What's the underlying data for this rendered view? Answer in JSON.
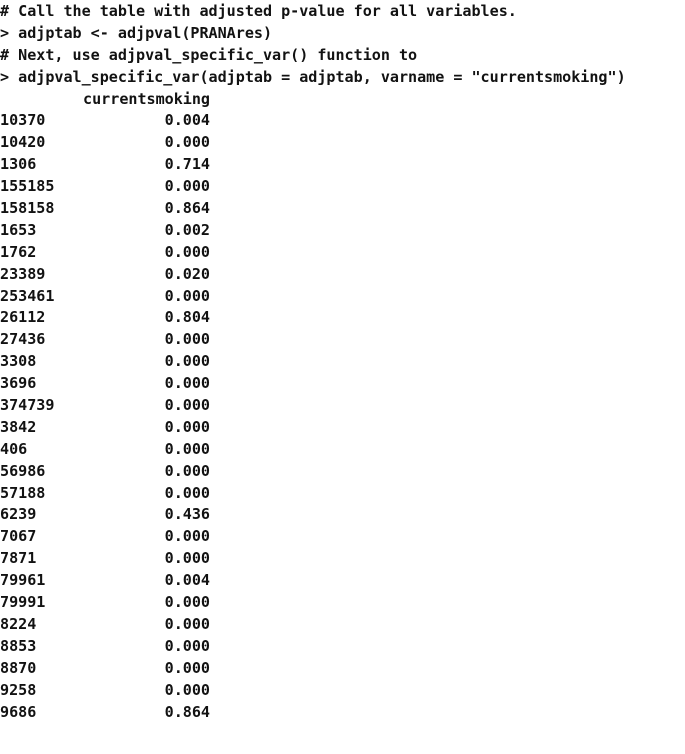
{
  "console": {
    "prompt_symbol": ">",
    "comment_symbol": "#",
    "lines": [
      "# Call the table with adjusted p-value for all variables.",
      "> adjptab <- adjpval(PRANAres)",
      "# Next, use adjpval_specific_var() function to",
      "> adjpval_specific_var(adjptab = adjptab, varname = \"currentsmoking\")"
    ]
  },
  "table": {
    "column_header": "currentsmoking",
    "rows": [
      {
        "name": "10370",
        "value": "0.004"
      },
      {
        "name": "10420",
        "value": "0.000"
      },
      {
        "name": "1306",
        "value": "0.714"
      },
      {
        "name": "155185",
        "value": "0.000"
      },
      {
        "name": "158158",
        "value": "0.864"
      },
      {
        "name": "1653",
        "value": "0.002"
      },
      {
        "name": "1762",
        "value": "0.000"
      },
      {
        "name": "23389",
        "value": "0.020"
      },
      {
        "name": "253461",
        "value": "0.000"
      },
      {
        "name": "26112",
        "value": "0.804"
      },
      {
        "name": "27436",
        "value": "0.000"
      },
      {
        "name": "3308",
        "value": "0.000"
      },
      {
        "name": "3696",
        "value": "0.000"
      },
      {
        "name": "374739",
        "value": "0.000"
      },
      {
        "name": "3842",
        "value": "0.000"
      },
      {
        "name": "406",
        "value": "0.000"
      },
      {
        "name": "56986",
        "value": "0.000"
      },
      {
        "name": "57188",
        "value": "0.000"
      },
      {
        "name": "6239",
        "value": "0.436"
      },
      {
        "name": "7067",
        "value": "0.000"
      },
      {
        "name": "7871",
        "value": "0.000"
      },
      {
        "name": "79961",
        "value": "0.004"
      },
      {
        "name": "79991",
        "value": "0.000"
      },
      {
        "name": "8224",
        "value": "0.000"
      },
      {
        "name": "8853",
        "value": "0.000"
      },
      {
        "name": "8870",
        "value": "0.000"
      },
      {
        "name": "9258",
        "value": "0.000"
      },
      {
        "name": "9686",
        "value": "0.864"
      }
    ]
  },
  "colors": {
    "background": "#ffffff",
    "text": "#121212"
  }
}
